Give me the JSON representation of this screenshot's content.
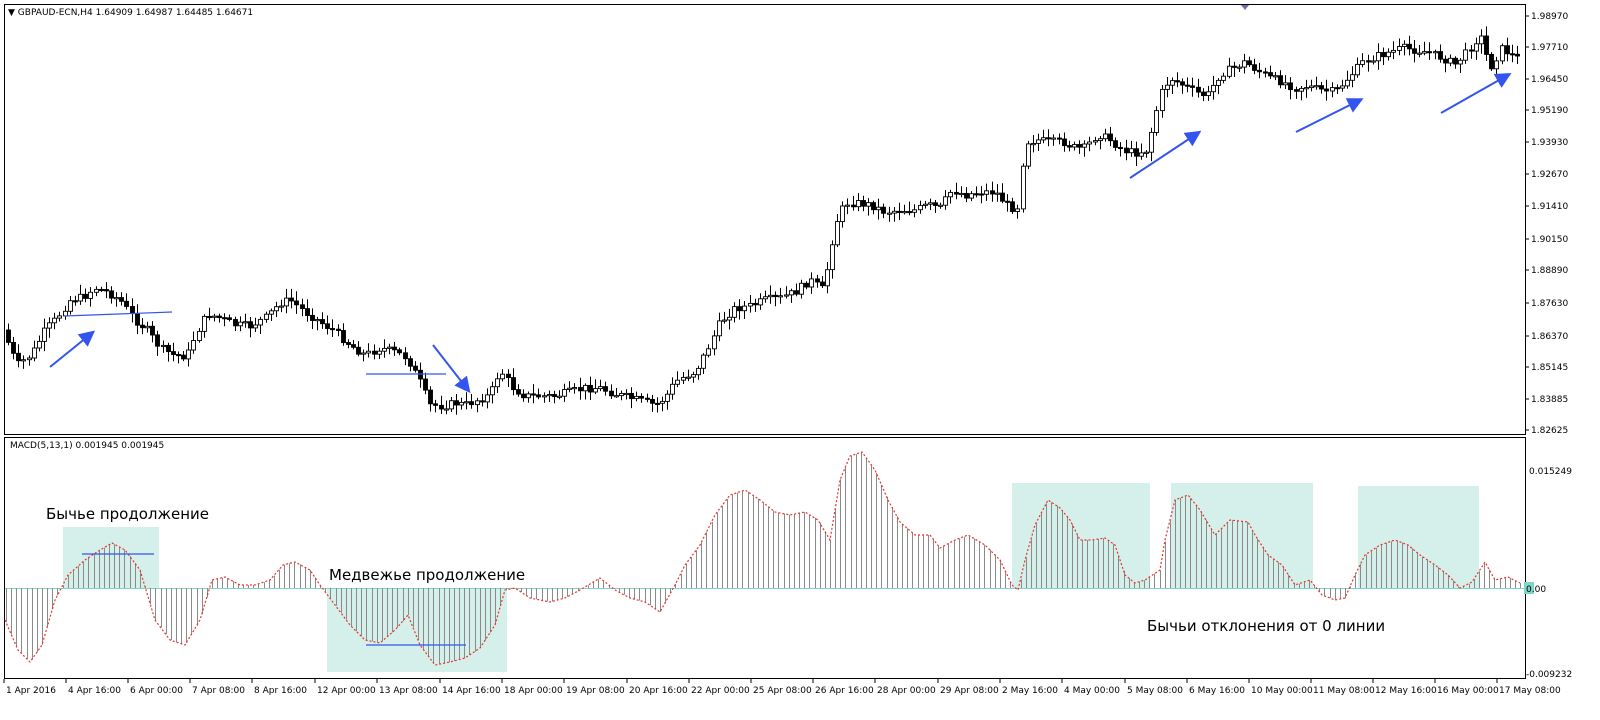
{
  "main_header": {
    "symbol": "GBPAUD-ECN,H4",
    "ohlc": "1.64909 1.64987 1.64485 1.64671"
  },
  "macd_header": {
    "label": "MACD(5,13,1) 0.001945 0.001945"
  },
  "annotations": {
    "bullish_continuation": "Бычье продолжение",
    "bearish_continuation": "Медвежье продолжение",
    "bullish_deviations": "Бычьи отклонения от 0 линии"
  },
  "price_axis": [
    "1.98970",
    "1.97710",
    "1.96450",
    "1.95190",
    "1.93930",
    "1.92670",
    "1.91410",
    "1.90150",
    "1.88890",
    "1.87630",
    "1.86370",
    "1.85145",
    "1.83885",
    "1.82625"
  ],
  "macd_axis": {
    "top": "0.015249",
    "zero": "0.00",
    "bottom": "-0.009232"
  },
  "time_axis": [
    "1 Apr 2016",
    "4 Apr 16:00",
    "6 Apr 00:00",
    "7 Apr 08:00",
    "8 Apr 16:00",
    "12 Apr 00:00",
    "13 Apr 08:00",
    "14 Apr 16:00",
    "18 Apr 00:00",
    "19 Apr 08:00",
    "20 Apr 16:00",
    "22 Apr 00:00",
    "25 Apr 08:00",
    "26 Apr 16:00",
    "28 Apr 00:00",
    "29 Apr 08:00",
    "2 May 16:00",
    "4 May 00:00",
    "5 May 08:00",
    "6 May 16:00",
    "10 May 00:00",
    "11 May 08:00",
    "12 May 16:00",
    "16 May 00:00",
    "17 May 08:00"
  ],
  "colors": {
    "arrow": "#3355ee",
    "highlight": "#d5f0ea",
    "zero_line": "#7fd6c8",
    "signal": "#e8322c",
    "histogram": "#8a8a8a"
  }
}
